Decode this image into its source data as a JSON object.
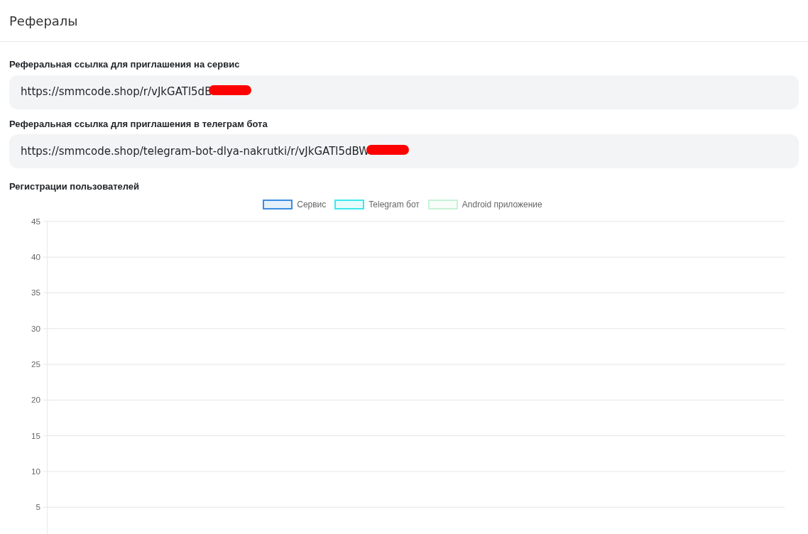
{
  "header": {
    "title": "Рефералы"
  },
  "links": [
    {
      "label": "Реферальная ссылка для приглашения на сервис",
      "value": "https://smmcode.shop/r/vJkGATl5dB",
      "redacted": true
    },
    {
      "label": "Реферальная ссылка для приглашения в телеграм бота",
      "value": "https://smmcode.shop/telegram-bot-dlya-nakrutki/r/vJkGATl5dBW",
      "redacted": true
    }
  ],
  "registrations": {
    "title": "Регистрации пользователей",
    "chart_data": {
      "type": "line",
      "grid": true,
      "ylim": [
        1.2,
        45
      ],
      "yticks": [
        5,
        10,
        15,
        20,
        25,
        30,
        35,
        40,
        45
      ],
      "series": [
        {
          "name": "Сервис",
          "color": "#3b8de0"
        },
        {
          "name": "Telegram бот",
          "color": "#3de8ee"
        },
        {
          "name": "Android приложение",
          "color": "#c8f2d6"
        }
      ]
    }
  }
}
